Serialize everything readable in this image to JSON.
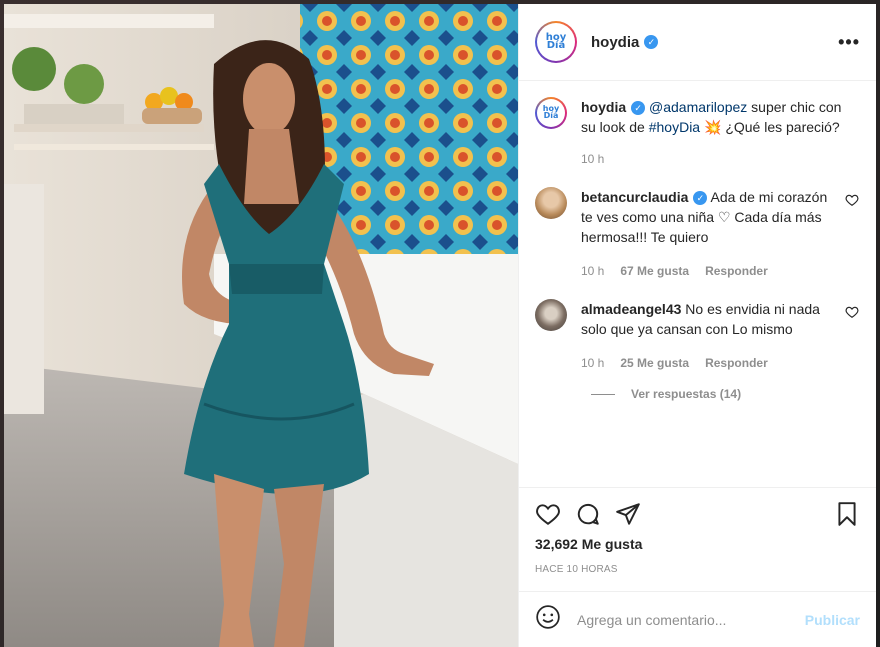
{
  "post": {
    "username": "hoydia",
    "logo_line1": "hoy",
    "logo_line2": "Día",
    "more_label": "•••",
    "caption": {
      "username": "hoydia",
      "mention": "@adamarilopez",
      "text1": " super chic con su look de ",
      "hashtag": "#hoyDia",
      "emoji": " 💥 ",
      "text2": "¿Qué les pareció?",
      "time": "10 h"
    },
    "comments": [
      {
        "username": "betancurclaudia",
        "text": "Ada de mi corazón te ves como una niña ♡ Cada día más hermosa!!! Te quiero",
        "time": "10 h",
        "likes": "67 Me gusta",
        "reply": "Responder"
      },
      {
        "username": "almadeangel43",
        "text": "No es envidia ni nada solo que ya cansan con Lo mismo",
        "time": "10 h",
        "likes": "25 Me gusta",
        "reply": "Responder"
      }
    ],
    "view_replies": "Ver respuestas (14)",
    "likes_count": "32,692 Me gusta",
    "posted_ago": "HACE 10 HORAS",
    "add_comment_placeholder": "Agrega un comentario...",
    "publish_label": "Publicar"
  },
  "colors": {
    "verified": "#3897f0",
    "link": "#00376b",
    "publish_disabled": "#b2dffc",
    "dress": "#1f6f7a"
  },
  "icons": [
    "verified-icon",
    "more-icon",
    "heart-icon",
    "comment-icon",
    "share-icon",
    "bookmark-icon",
    "emoji-icon"
  ]
}
